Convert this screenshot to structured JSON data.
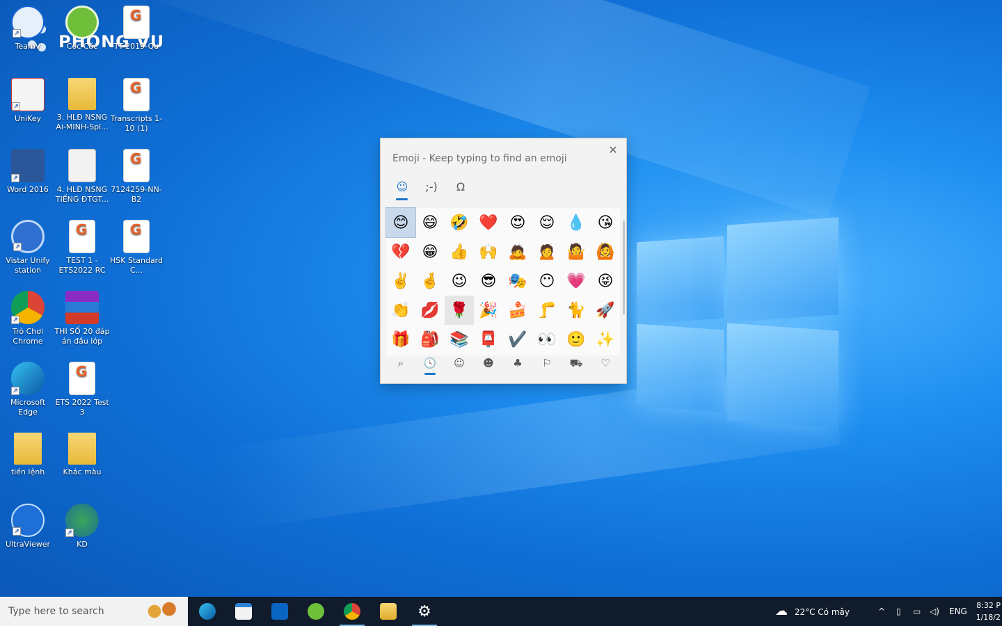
{
  "desktop": {
    "brand": "PHONG VU",
    "icons": [
      {
        "label": "TeamV"
      },
      {
        "label": "Cốc Cốc"
      },
      {
        "label": "TT-2019-Qu"
      },
      {
        "label": "UniKey"
      },
      {
        "label": "3. HLĐ NSNG Ai-MINH-Spl..."
      },
      {
        "label": "Transcripts 1-10 (1)"
      },
      {
        "label": "Word 2016"
      },
      {
        "label": "4. HLĐ NSNG TIẾNG ĐTGT..."
      },
      {
        "label": "7124259-NN-B2"
      },
      {
        "label": "Vistar Unify station"
      },
      {
        "label": "TEST 1 - ETS2022 RC"
      },
      {
        "label": "HSK Standard C..."
      },
      {
        "label": "Trò Chơi Chrome"
      },
      {
        "label": "THI SỐ 20 đáp án đầu lớp"
      },
      {
        "label": "Microsoft Edge"
      },
      {
        "label": "ETS 2022 Test 3"
      },
      {
        "label": "tiền lệnh"
      },
      {
        "label": "Khác màu"
      },
      {
        "label": "UltraViewer"
      },
      {
        "label": "KD"
      }
    ]
  },
  "emoji_panel": {
    "title": "Emoji - Keep typing to find an emoji",
    "close_icon": "✕",
    "tabs": [
      {
        "name": "emoji-tab",
        "glyph": "☺",
        "active": true
      },
      {
        "name": "kaomoji-tab",
        "glyph": ";-)",
        "active": false
      },
      {
        "name": "symbols-tab",
        "glyph": "Ω",
        "active": false
      }
    ],
    "grid": [
      "😊",
      "😄",
      "🤣",
      "❤️",
      "😍",
      "😌",
      "💧",
      "😘",
      "💔",
      "😁",
      "👍",
      "🙌",
      "🙇",
      "🙍",
      "🤷",
      "🙆",
      "✌️",
      "🤞",
      "😉",
      "😎",
      "🎭",
      "😶",
      "💗",
      "😝",
      "👏",
      "💋",
      "🌹",
      "🎉",
      "🍰",
      "🦵",
      "🐈",
      "🚀",
      "🎁",
      "🎒",
      "📚",
      "📮",
      "✔️",
      "👀",
      "🙂",
      "✨"
    ],
    "categories": [
      {
        "name": "search-category",
        "glyph": "⌕"
      },
      {
        "name": "recent-category",
        "glyph": "🕓",
        "active": true
      },
      {
        "name": "smiley-category",
        "glyph": "☺"
      },
      {
        "name": "people-category",
        "glyph": "☻"
      },
      {
        "name": "celebration-category",
        "glyph": "♣"
      },
      {
        "name": "food-category",
        "glyph": "⚐"
      },
      {
        "name": "travel-category",
        "glyph": "⛟"
      },
      {
        "name": "heart-category",
        "glyph": "♡"
      }
    ]
  },
  "taskbar": {
    "search_placeholder": "Type here to search",
    "apps": [
      "edge",
      "store",
      "outlook",
      "coccoc",
      "chrome",
      "explorer",
      "settings"
    ],
    "weather": "22°C  Có mây",
    "language": "ENG",
    "time": "8:32 P",
    "date": "1/18/2"
  },
  "colors": {
    "accent": "#1a73c9",
    "taskbar": "#101b2b",
    "desktop_blue": "#0f6fd6"
  }
}
